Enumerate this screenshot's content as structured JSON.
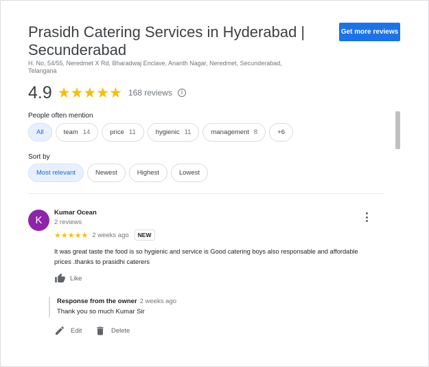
{
  "business": {
    "name": "Prasidh Catering Services in Hyderabad | Secunderabad",
    "address": "H. No, 54/55, Neredmet X Rd, Bharadwaj Enclave, Ananth Nagar, Neredmet, Secunderabad, Telangana",
    "get_more_reviews_label": "Get more reviews"
  },
  "rating": {
    "value": "4.9",
    "stars": "★★★★★",
    "review_count": "168 reviews",
    "info_icon": "i"
  },
  "mentions": {
    "label": "People often mention",
    "chips": [
      {
        "label": "All",
        "count": "",
        "selected": true
      },
      {
        "label": "team",
        "count": "14"
      },
      {
        "label": "price",
        "count": "11"
      },
      {
        "label": "hygienic",
        "count": "11"
      },
      {
        "label": "management",
        "count": "8"
      },
      {
        "label": "+6",
        "count": ""
      }
    ]
  },
  "sort": {
    "label": "Sort by",
    "options": [
      {
        "label": "Most relevant",
        "selected": true
      },
      {
        "label": "Newest"
      },
      {
        "label": "Highest"
      },
      {
        "label": "Lowest"
      }
    ]
  },
  "review": {
    "avatar_letter": "K",
    "avatar_color": "#8e24aa",
    "reviewer_name": "Kumar Ocean",
    "reviewer_review_count": "2 reviews",
    "stars": "★★★★★",
    "date": "2 weeks ago",
    "badge": "NEW",
    "text": "It was great taste the  food is so hygienic and service is Good catering boys also  responsable  and affordable prices .thanks to prasidhi caterers",
    "like_label": "Like",
    "owner_response": {
      "title": "Response from the owner",
      "date": "2 weeks ago",
      "text": "Thank you so much Kumar Sir"
    },
    "edit_label": "Edit",
    "delete_label": "Delete"
  },
  "colors": {
    "accent": "#1a73e8",
    "star": "#fbbc04",
    "selected_chip_bg": "#e8f0fe",
    "selected_chip_text": "#1967d2"
  }
}
